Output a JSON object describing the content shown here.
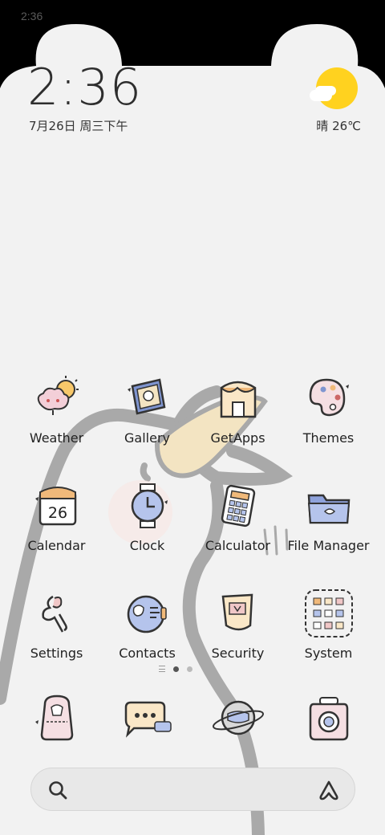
{
  "status_bar": {
    "time": "2:36"
  },
  "clock_widget": {
    "time": "2:36",
    "date": "7月26日 周三下午"
  },
  "weather_widget": {
    "text": "晴 26℃",
    "sun_color": "#ffd21f"
  },
  "apps": [
    {
      "label": "Weather",
      "icon": "weather-cloud-sun-icon"
    },
    {
      "label": "Gallery",
      "icon": "gallery-frame-icon"
    },
    {
      "label": "GetApps",
      "icon": "getapps-store-icon"
    },
    {
      "label": "Themes",
      "icon": "palette-icon"
    },
    {
      "label": "Calendar",
      "icon": "calendar-icon",
      "day": "26"
    },
    {
      "label": "Clock",
      "icon": "clock-icon"
    },
    {
      "label": "Calculator",
      "icon": "calculator-icon"
    },
    {
      "label": "File Manager",
      "icon": "folder-icon"
    },
    {
      "label": "Settings",
      "icon": "settings-ribbon-icon"
    },
    {
      "label": "Contacts",
      "icon": "contacts-icon"
    },
    {
      "label": "Security",
      "icon": "security-shield-icon"
    },
    {
      "label": "System",
      "icon": "system-folder-icon"
    }
  ],
  "pager": {
    "pages": 2,
    "active_page": 1
  },
  "dock": [
    {
      "icon": "backpack-icon"
    },
    {
      "icon": "message-bubble-icon"
    },
    {
      "icon": "planet-icon"
    },
    {
      "icon": "camera-icon"
    }
  ],
  "search": {
    "icon": "search-icon",
    "assistant_icon": "assistant-icon"
  },
  "colors": {
    "background": "#f2f2f2",
    "accent_yellow": "#ffd21f",
    "duck_outline": "#a8a8a8"
  }
}
